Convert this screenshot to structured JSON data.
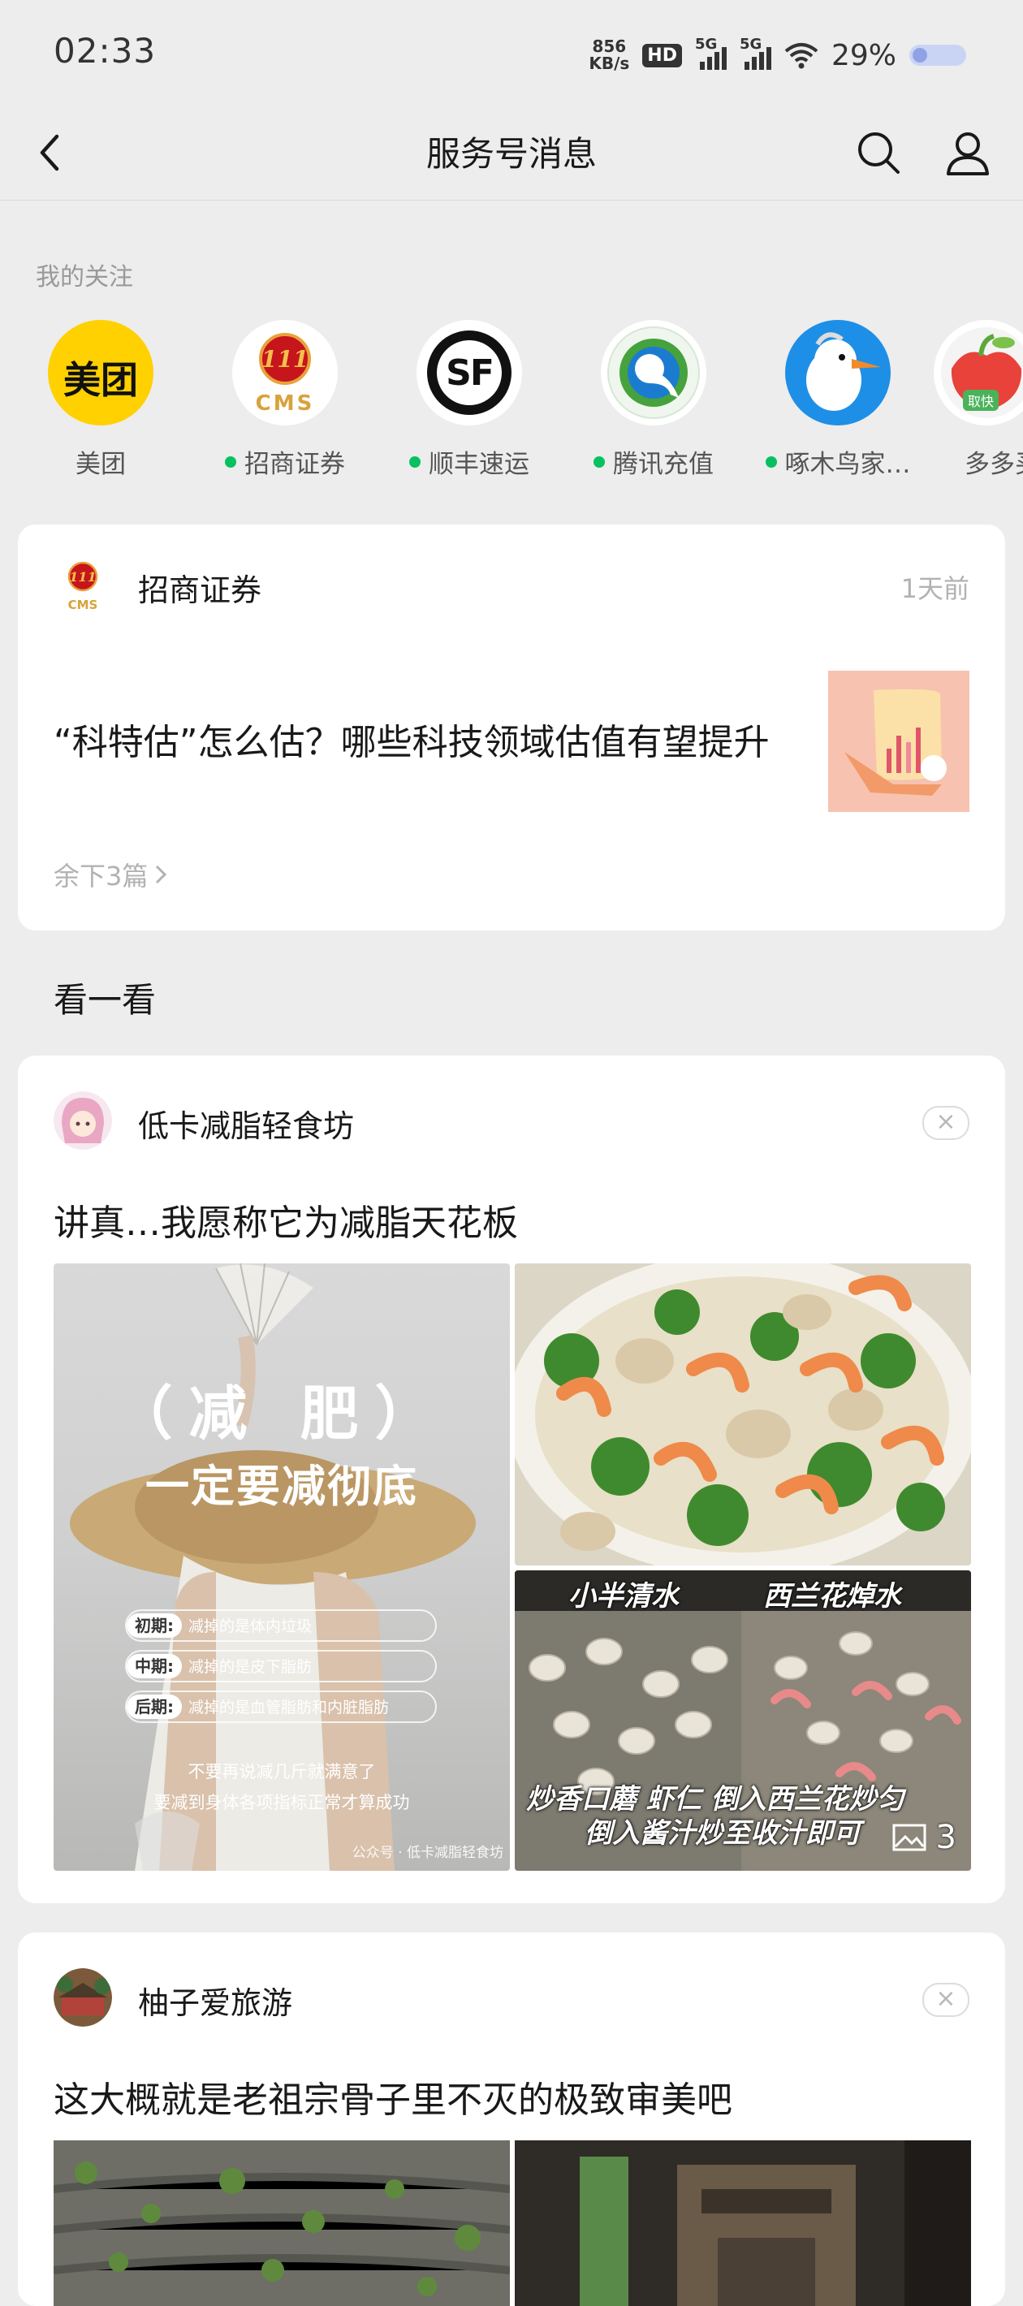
{
  "status_bar": {
    "time": "02:33",
    "net_speed_value": "856",
    "net_speed_unit": "KB/s",
    "hd": "HD",
    "signal1": "5G",
    "signal2": "5G",
    "battery": "29%"
  },
  "nav": {
    "title": "服务号消息"
  },
  "follow": {
    "label": "我的关注",
    "accounts": [
      {
        "name": "美团",
        "dot": false
      },
      {
        "name": "招商证券",
        "dot": true
      },
      {
        "name": "顺丰速运",
        "dot": true
      },
      {
        "name": "腾讯充值",
        "dot": true
      },
      {
        "name": "啄木鸟家…",
        "dot": true
      },
      {
        "name": "多多买",
        "dot": false
      }
    ],
    "meituan_logo_text": "美团",
    "cms_logo_text": "CMS",
    "sf_logo_text": "SF",
    "pdd_logo_text": "取快"
  },
  "card1": {
    "account": "招商证券",
    "time": "1天前",
    "article_title": "“科特估”怎么估？哪些科技领域估值有望提升",
    "more": "余下3篇"
  },
  "section": {
    "title": "看一看"
  },
  "card2": {
    "account": "低卡减脂轻食坊",
    "title": "讲真…我愿称它为减脂天花板",
    "image_main": {
      "headline1": "（减 肥）",
      "headline2": "一定要减彻底",
      "stage1_tag": "初期:",
      "stage1_text": "减掉的是体内垃圾",
      "stage2_tag": "中期:",
      "stage2_text": "减掉的是皮下脂肪",
      "stage3_tag": "后期:",
      "stage3_text": "减掉的是血管脂肪和内脏脂肪",
      "footer1": "不要再说减几斤就满意了",
      "footer2": "要减到身体各项指标正常才算成功",
      "watermark": "公众号 · 低卡减脂轻食坊"
    },
    "image_br": {
      "cap1": "小半清水",
      "cap2": "西兰花焯水",
      "cap3": "炒香口蘑 虾仁 倒入西兰花炒匀",
      "cap4": "倒入酱汁炒至收汁即可"
    },
    "image_count": "3"
  },
  "card3": {
    "account": "柚子爱旅游",
    "title": "这大概就是老祖宗骨子里不灭的极致审美吧"
  },
  "colors": {
    "background": "#ededed",
    "online_dot": "#07c160",
    "meituan_yellow": "#ffd100"
  }
}
